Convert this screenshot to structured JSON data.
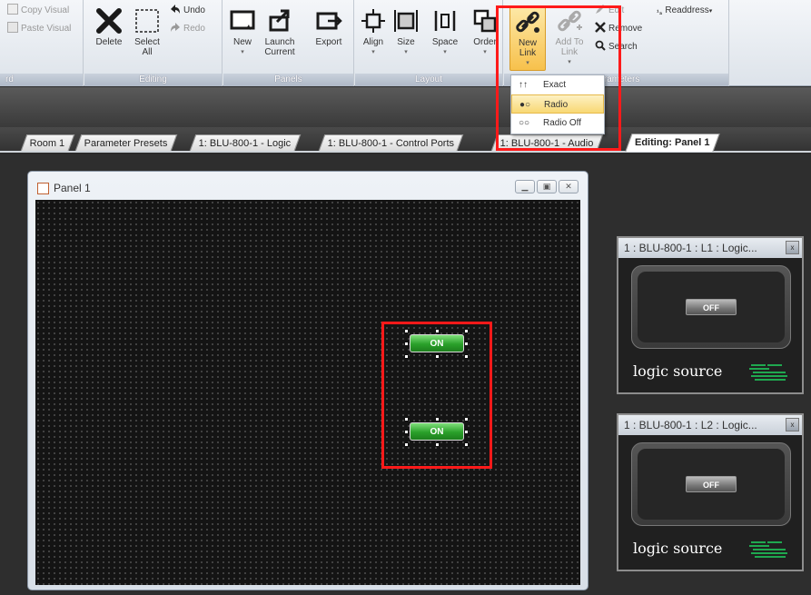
{
  "ribbon": {
    "clipboard": {
      "copy_visual": "Copy Visual",
      "paste_visual": "Paste Visual",
      "group_label": "rd"
    },
    "editing": {
      "delete": "Delete",
      "select_all": "Select All",
      "undo": "Undo",
      "redo": "Redo",
      "group_label": "Editing"
    },
    "panels": {
      "new": "New",
      "launch_current": "Launch Current",
      "export": "Export",
      "group_label": "Panels"
    },
    "layout": {
      "align": "Align",
      "size": "Size",
      "space": "Space",
      "order": "Order",
      "group_label": "Layout"
    },
    "parameters": {
      "new_link": "New Link",
      "add_to_link": "Add To Link",
      "edit": "Edit",
      "remove": "Remove",
      "search": "Search",
      "readdress": "Readdress",
      "group_label": "Parameters"
    }
  },
  "dropdown": {
    "items": [
      {
        "label": "Exact",
        "icon": "exact-link-icon",
        "glyph": "↑↑",
        "highlighted": false
      },
      {
        "label": "Radio",
        "icon": "radio-link-icon",
        "glyph": "●○",
        "highlighted": true
      },
      {
        "label": "Radio Off",
        "icon": "radio-off-icon",
        "glyph": "○○",
        "highlighted": false
      }
    ]
  },
  "tabs": [
    {
      "label": "Room 1"
    },
    {
      "label": "Parameter Presets"
    },
    {
      "label": "1: BLU-800-1 - Logic"
    },
    {
      "label": "1: BLU-800-1 - Control Ports"
    },
    {
      "label": "1: BLU-800-1 - Audio"
    },
    {
      "label": "Editing: Panel 1",
      "active": true
    }
  ],
  "panel": {
    "title": "Panel 1",
    "buttons": [
      {
        "label": "ON"
      },
      {
        "label": "ON"
      }
    ]
  },
  "modules": [
    {
      "title": "1 : BLU-800-1 : L1 : Logic...",
      "button": "OFF",
      "label": "logic source"
    },
    {
      "title": "1 : BLU-800-1 : L2 : Logic...",
      "button": "OFF",
      "label": "logic source"
    }
  ],
  "colors": {
    "highlight_box": "#ff1a1a",
    "on_button": "#2aa02a",
    "bss_logo": "#1fa84f"
  }
}
